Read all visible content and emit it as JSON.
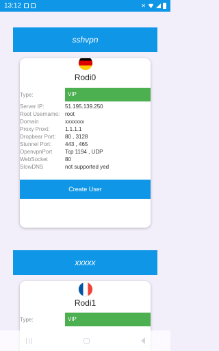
{
  "status_bar": {
    "time": "13:12"
  },
  "servers": [
    {
      "header": "sshvpn",
      "name": "Rodi0",
      "flag": "germany-flag-icon",
      "type_label": "Type:",
      "type_value": "VIP",
      "fields": [
        {
          "label": "Server IP:",
          "value": "51.195.139.250"
        },
        {
          "label": "Root Username:",
          "value": "root"
        },
        {
          "label": "Domain",
          "value": "xxxxxxx"
        },
        {
          "label": "Proxy Proxt:",
          "value": "1.1.1.1"
        },
        {
          "label": "Dropbear Port:",
          "value": "80 , 3128"
        },
        {
          "label": "Stunnel Port:",
          "value": "443 , 465"
        },
        {
          "label": "OpenvpnPort",
          "value": "Tcp 1194 , UDP"
        },
        {
          "label": "WebSocket",
          "value": "80"
        },
        {
          "label": "SlowDNS",
          "value": "not supported yed"
        }
      ],
      "button": "Create User"
    },
    {
      "header": "xxxxx",
      "name": "Rodi1",
      "flag": "france-flag-icon",
      "type_label": "Type:",
      "type_value": "VIP"
    }
  ],
  "colors": {
    "primary": "#0f96e6",
    "vip": "#4caf50",
    "background": "#f3effa"
  }
}
